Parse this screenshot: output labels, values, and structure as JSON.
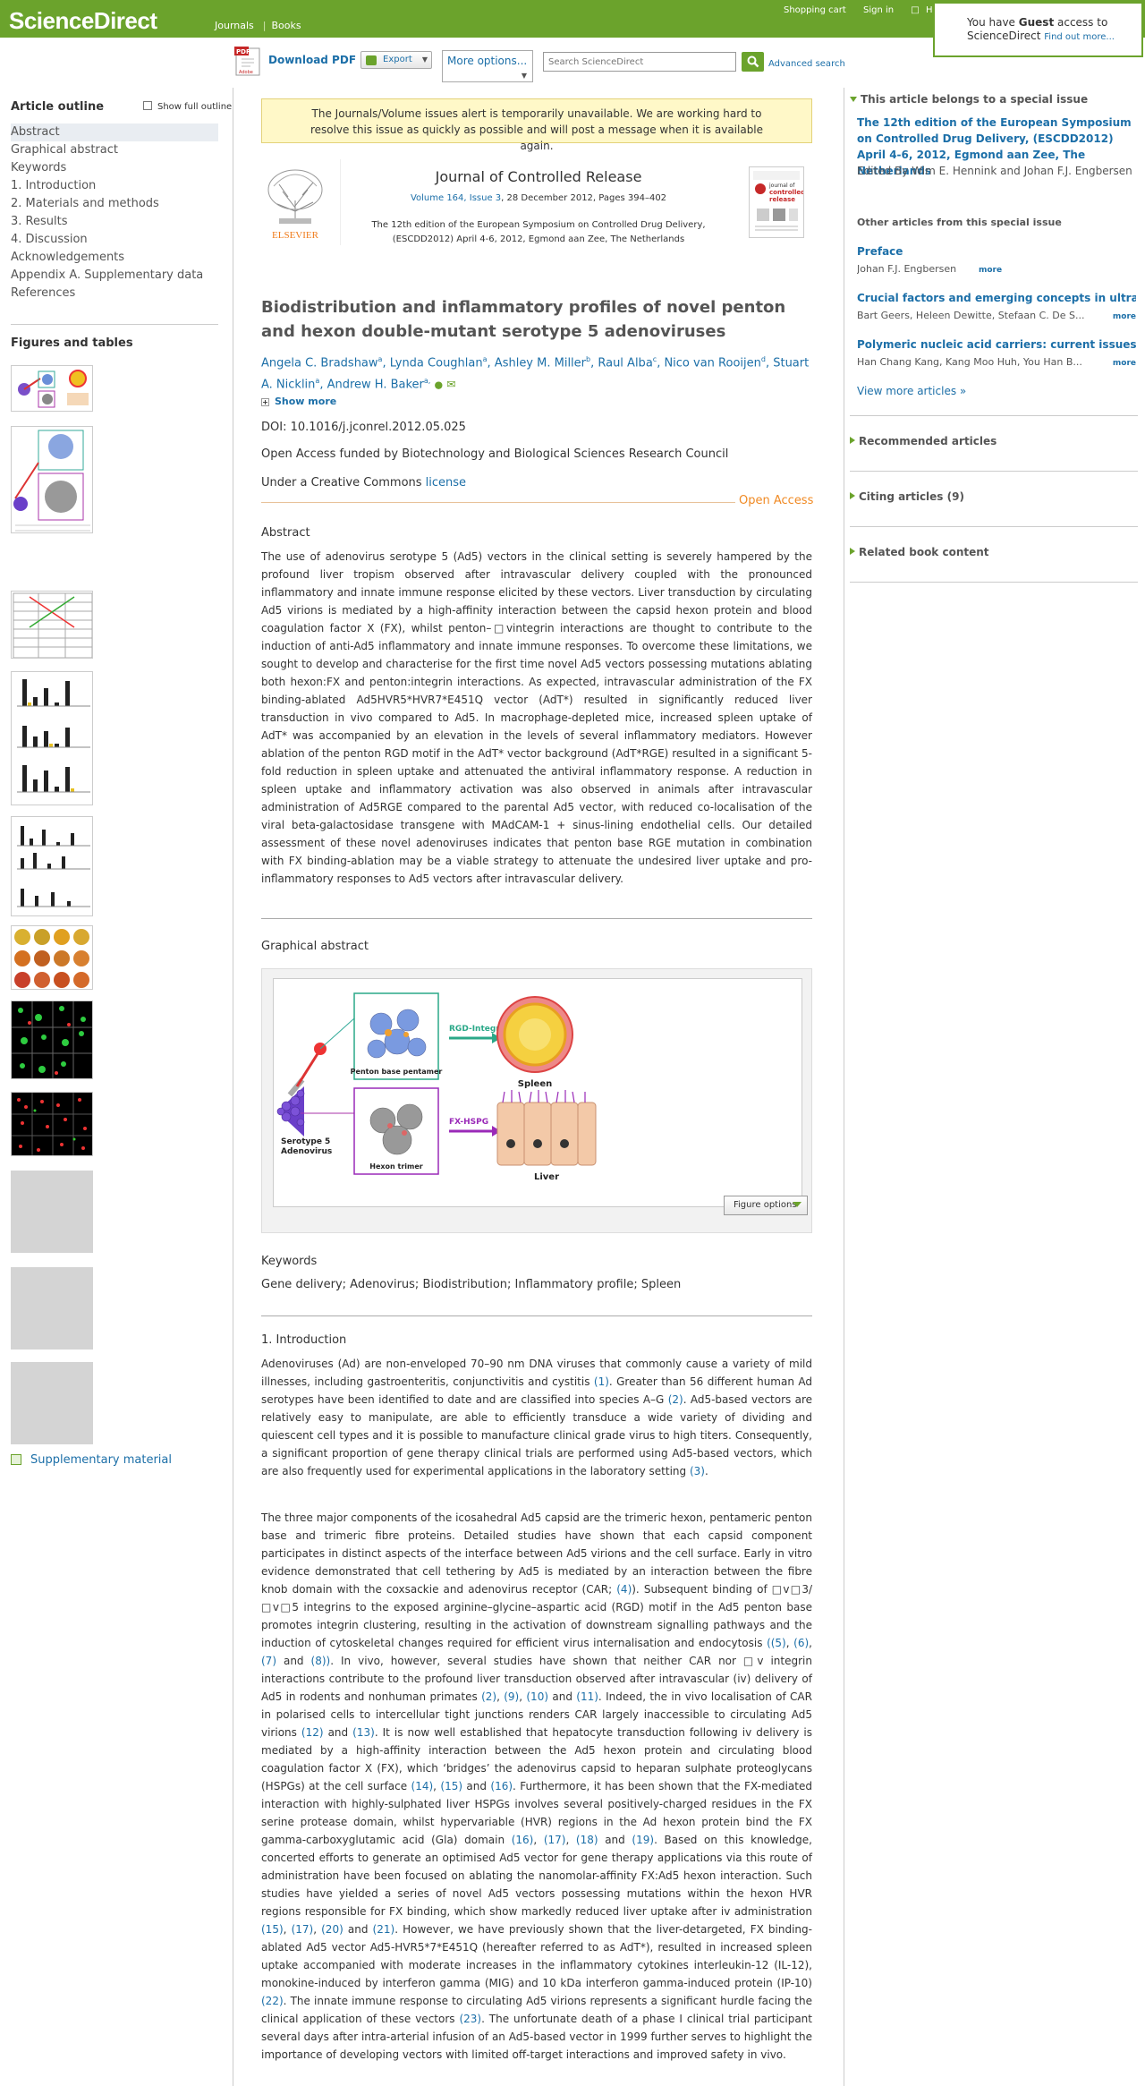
{
  "brand": {
    "logo": "ScienceDirect",
    "green": "#6ba32c",
    "link": "#1c6fa8"
  },
  "topnav": {
    "journals": "Journals",
    "books": "Books",
    "shopping_cart": "Shopping cart",
    "sign_in": "Sign in",
    "help": "Help"
  },
  "guest": {
    "pre": "You have ",
    "bold": "Guest",
    "post": " access to",
    "line2": "ScienceDirect ",
    "find_out": "Find out more..."
  },
  "toolbar": {
    "download_pdf": "Download PDF",
    "export": "Export",
    "more_options": "More options...",
    "search_placeholder": "Search ScienceDirect",
    "advanced_search": "Advanced search"
  },
  "outline": {
    "title": "Article outline",
    "show_full": "Show full outline",
    "items": [
      "Abstract",
      "Graphical abstract",
      "Keywords",
      "1. Introduction",
      "2. Materials and methods",
      "3. Results",
      "4. Discussion",
      "Acknowledgements",
      "Appendix A. Supplementary data",
      "References"
    ]
  },
  "figures": {
    "title": "Figures and tables",
    "supplementary": "Supplementary material"
  },
  "alert": "The Journals/Volume issues alert is temporarily unavailable. We are working hard to resolve this issue as quickly as possible and will post a message when it is available again.",
  "journal": {
    "name": "Journal of Controlled Release",
    "volume_link": "Volume 164, Issue 3",
    "volume_rest": ", 28 December 2012, Pages 394–402",
    "special": "The 12th edition of the European Symposium on Controlled Drug Delivery, (ESCDD2012) April 4-6, 2012, Egmond aan Zee, The Netherlands",
    "publisher": "ELSEVIER"
  },
  "article": {
    "title": "Biodistribution and inflammatory profiles of novel penton and hexon double-mutant serotype 5 adenoviruses",
    "authors": [
      {
        "name": "Angela C. Bradshaw",
        "sup": "a"
      },
      {
        "name": "Lynda Coughlan",
        "sup": "a"
      },
      {
        "name": "Ashley M. Miller",
        "sup": "b"
      },
      {
        "name": "Raul Alba",
        "sup": "c"
      },
      {
        "name": "Nico van Rooijen",
        "sup": "d"
      },
      {
        "name": "Stuart A. Nicklin",
        "sup": "a"
      },
      {
        "name": "Andrew H. Baker",
        "sup": "a,"
      }
    ],
    "show_more": "Show more",
    "doi": "DOI: 10.1016/j.jconrel.2012.05.025",
    "funded": "Open Access funded by Biotechnology and Biological Sciences Research Council",
    "license_pre": "Under a Creative Commons ",
    "license_link": "license",
    "open_access": "Open Access"
  },
  "abstract": {
    "heading": "Abstract",
    "text": "The use of adenovirus serotype 5 (Ad5) vectors in the clinical setting is severely hampered by the profound liver tropism observed after intravascular delivery coupled with the pronounced inflammatory and innate immune response elicited by these vectors. Liver transduction by circulating Ad5 virions is mediated by a high-affinity interaction between the capsid hexon protein and blood coagulation factor X (FX), whilst penton–□vintegrin interactions are thought to contribute to the induction of anti-Ad5 inflammatory and innate immune responses. To overcome these limitations, we sought to develop and characterise for the first time novel Ad5 vectors possessing mutations ablating both hexon:FX and penton:integrin interactions. As expected, intravascular administration of the FX binding-ablated Ad5HVR5*HVR7*E451Q vector (AdT*) resulted in significantly reduced liver transduction in vivo compared to Ad5. In macrophage-depleted mice, increased spleen uptake of AdT* was accompanied by an elevation in the levels of several inflammatory mediators. However ablation of the penton RGD motif in the AdT* vector background (AdT*RGE) resulted in a significant 5-fold reduction in spleen uptake and attenuated the antiviral inflammatory response. A reduction in spleen uptake and inflammatory activation was also observed in animals after intravascular administration of Ad5RGE compared to the parental Ad5 vector, with reduced co-localisation of the viral beta-galactosidase transgene with MAdCAM-1 + sinus-lining endothelial cells. Our detailed assessment of these novel adenoviruses indicates that penton base RGE mutation in combination with FX binding-ablation may be a viable strategy to attenuate the undesired liver uptake and pro-inflammatory responses to Ad5 vectors after intravascular delivery."
  },
  "graphical_abstract": {
    "heading": "Graphical abstract",
    "labels": {
      "rgd": "RGD-Integrin",
      "fx": "FX-HSPG",
      "penton": "Penton base pentamer",
      "hexon": "Hexon trimer",
      "spleen": "Spleen",
      "liver": "Liver",
      "serotype": "Serotype 5\nAdenovirus"
    },
    "figure_options": "Figure options"
  },
  "keywords": {
    "heading": "Keywords",
    "text": "Gene delivery; Adenovirus; Biodistribution; Inflammatory profile; Spleen"
  },
  "intro": {
    "heading": "1. Introduction",
    "p1": [
      {
        "t": "Adenoviruses (Ad) are non-enveloped 70–90 nm DNA viruses that commonly cause a variety of mild illnesses, including gastroenteritis, conjunctivitis and cystitis "
      },
      {
        "l": "(1)"
      },
      {
        "t": ". Greater than 56 different human Ad serotypes have been identified to date and are classified into species A–G "
      },
      {
        "l": "(2)"
      },
      {
        "t": ". Ad5-based vectors are relatively easy to manipulate, are able to efficiently transduce a wide variety of dividing and quiescent cell types and it is possible to manufacture clinical grade virus to high titers. Consequently, a significant proportion of gene therapy clinical trials are performed using Ad5-based vectors, which are also frequently used for experimental applications in the laboratory setting "
      },
      {
        "l": "(3)"
      },
      {
        "t": "."
      }
    ],
    "p2": [
      {
        "t": "The three major components of the icosahedral Ad5 capsid are the trimeric hexon, pentameric penton base and trimeric fibre proteins. Detailed studies have shown that each capsid component participates in distinct aspects of the interface between Ad5 virions and the cell surface. Early in vitro evidence demonstrated that cell tethering by Ad5 is mediated by an interaction between the fibre knob domain with the coxsackie and adenovirus receptor (CAR; "
      },
      {
        "l": "(4)"
      },
      {
        "t": "). Subsequent binding of □v□3/□v□5 integrins to the exposed arginine–glycine–aspartic acid (RGD) motif in the Ad5 penton base promotes integrin clustering, resulting in the activation of downstream signalling pathways and the induction of cytoskeletal changes required for efficient virus internalisation and endocytosis "
      },
      {
        "l": "((5)"
      },
      {
        "t": ", "
      },
      {
        "l": "(6)"
      },
      {
        "t": ", "
      },
      {
        "l": "(7)"
      },
      {
        "t": " and "
      },
      {
        "l": "(8))"
      },
      {
        "t": ". In vivo, however, several studies have shown that neither CAR nor □v integrin interactions contribute to the profound liver transduction observed after intravascular (iv) delivery of Ad5 in rodents and nonhuman primates "
      },
      {
        "l": "(2)"
      },
      {
        "t": ", "
      },
      {
        "l": "(9)"
      },
      {
        "t": ", "
      },
      {
        "l": "(10)"
      },
      {
        "t": " and "
      },
      {
        "l": "(11)"
      },
      {
        "t": ". Indeed, the in vivo localisation of CAR in polarised cells to intercellular tight junctions renders CAR largely inaccessible to circulating Ad5 virions "
      },
      {
        "l": "(12)"
      },
      {
        "t": " and "
      },
      {
        "l": "(13)"
      },
      {
        "t": ". It is now well established that hepatocyte transduction following iv delivery is mediated by a high-affinity interaction between the Ad5 hexon protein and circulating blood coagulation factor X (FX), which ‘bridges’ the adenovirus capsid to heparan sulphate proteoglycans (HSPGs) at the cell surface "
      },
      {
        "l": "(14)"
      },
      {
        "t": ", "
      },
      {
        "l": "(15)"
      },
      {
        "t": " and "
      },
      {
        "l": "(16)"
      },
      {
        "t": ". Furthermore, it has been shown that the FX-mediated interaction with highly-sulphated liver HSPGs involves several positively-charged residues in the FX serine protease domain, whilst hypervariable (HVR) regions in the Ad hexon protein bind the FX gamma-carboxyglutamic acid (Gla) domain "
      },
      {
        "l": "(16)"
      },
      {
        "t": ", "
      },
      {
        "l": "(17)"
      },
      {
        "t": ", "
      },
      {
        "l": "(18)"
      },
      {
        "t": " and "
      },
      {
        "l": "(19)"
      },
      {
        "t": ". Based on this knowledge, concerted efforts to generate an optimised Ad5 vector for gene therapy applications via this route of administration have been focused on ablating the nanomolar-affinity FX:Ad5 hexon interaction. Such studies have yielded a series of novel Ad5 vectors possessing mutations within the hexon HVR regions responsible for FX binding, which show markedly reduced liver uptake after iv administration "
      },
      {
        "l": "(15)"
      },
      {
        "t": ", "
      },
      {
        "l": "(17)"
      },
      {
        "t": ", "
      },
      {
        "l": "(20)"
      },
      {
        "t": " and "
      },
      {
        "l": "(21)"
      },
      {
        "t": ". However, we have previously shown that the liver-detargeted, FX binding-ablated Ad5 vector Ad5-HVR5*7*E451Q (hereafter referred to as AdT*), resulted in increased spleen uptake accompanied with moderate increases in the inflammatory cytokines interleukin-12 (IL-12), monokine-induced by interferon gamma (MIG) and 10 kDa interferon gamma-induced protein (IP-10) "
      },
      {
        "l": "(22)"
      },
      {
        "t": ". The innate immune response to circulating Ad5 virions represents a significant hurdle facing the clinical application of these vectors "
      },
      {
        "l": "(23)"
      },
      {
        "t": ". The unfortunate death of a phase I clinical trial participant several days after intra-arterial infusion of an Ad5-based vector in 1999 further serves to highlight the importance of developing vectors with limited off-target interactions and improved safety in vivo."
      }
    ]
  },
  "sidebar": {
    "special_issue_heading": "This article belongs to a special issue",
    "special_issue_title": "The 12th edition of the European Symposium on Controlled Drug Delivery, (ESCDD2012) April 4-6, 2012, Egmond aan Zee, The Netherlands",
    "special_issue_editors": "Edited By Wim E. Hennink and Johan F.J. Engbersen",
    "other_heading": "Other articles from this special issue",
    "others": [
      {
        "title": "Preface",
        "authors": "Johan F.J. Engbersen",
        "more": "more"
      },
      {
        "title": "Crucial factors and emerging concepts in ultras..",
        "authors": "Bart Geers, Heleen Dewitte, Stefaan C. De S...",
        "more": "more"
      },
      {
        "title": "Polymeric nucleic acid carriers: current issues ...",
        "authors": "Han Chang Kang, Kang Moo Huh, You Han B...",
        "more": "more"
      }
    ],
    "view_more": "View more articles »",
    "recommended": "Recommended articles",
    "citing": "Citing articles (9)",
    "related": "Related book content"
  }
}
